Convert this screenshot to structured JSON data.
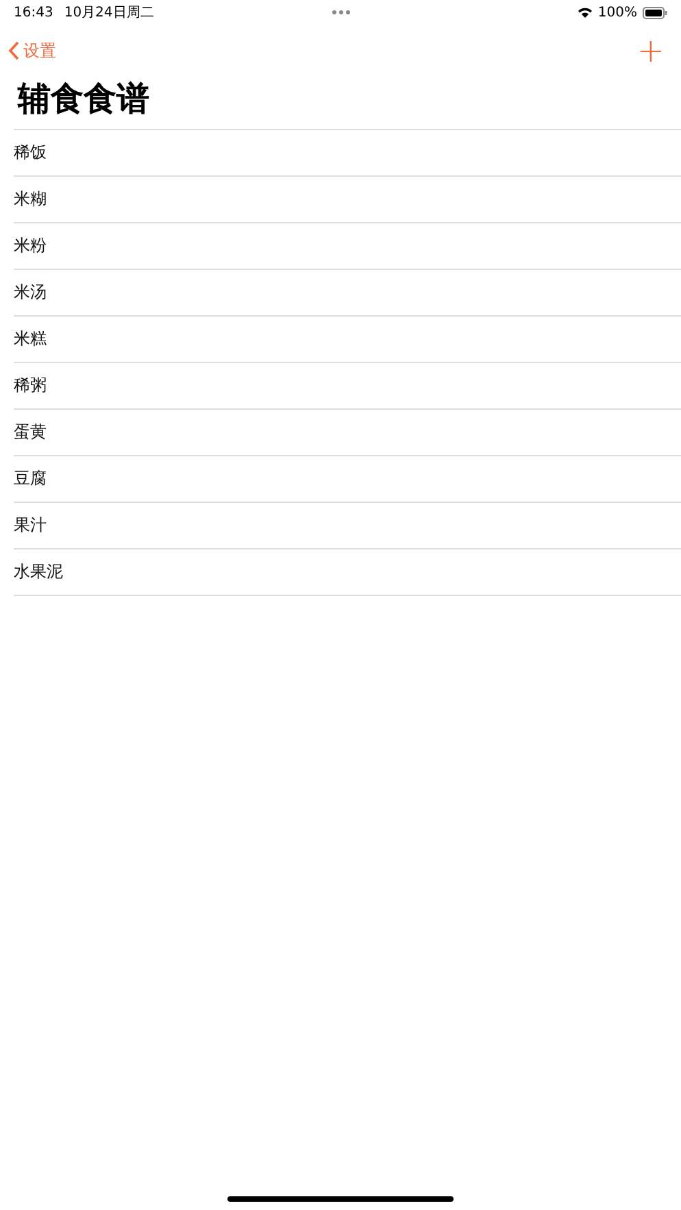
{
  "status_bar": {
    "time": "16:43",
    "date": "10月24日周二",
    "battery": "100%"
  },
  "nav": {
    "back": "设置",
    "add": "+"
  },
  "title": "辅食食谱",
  "items": [
    "稀饭",
    "米糊",
    "米粉",
    "米汤",
    "米糕",
    "稀粥",
    "蛋黄",
    "豆腐",
    "果汁",
    "水果泥"
  ]
}
